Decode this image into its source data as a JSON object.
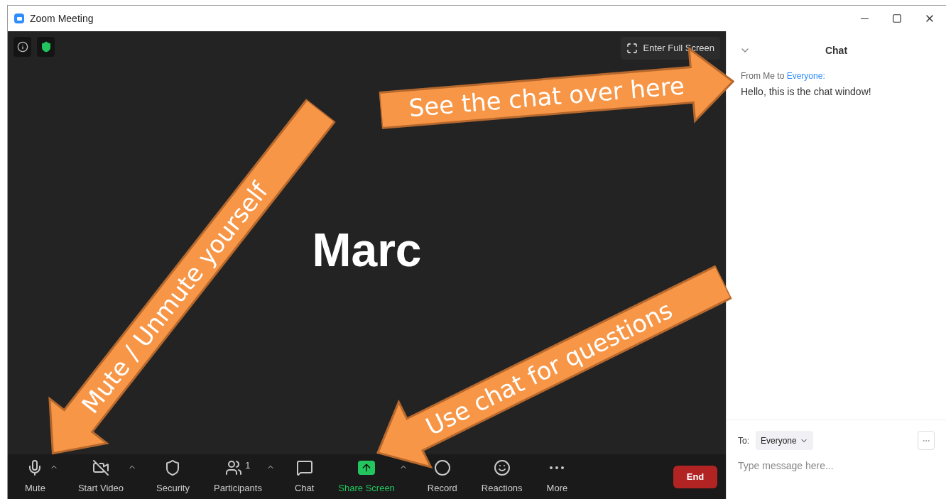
{
  "window": {
    "title": "Zoom Meeting"
  },
  "video": {
    "participant_name": "Marc",
    "full_screen_button": "Enter Full Screen"
  },
  "toolbar": {
    "items": [
      {
        "kind": "mic",
        "label": "Mute",
        "caret": true,
        "highlighted": false
      },
      {
        "kind": "video-off",
        "label": "Start Video",
        "caret": true,
        "highlighted": false
      },
      {
        "kind": "security",
        "label": "Security",
        "caret": false,
        "highlighted": false
      },
      {
        "kind": "participants",
        "label": "Participants",
        "count": "1",
        "caret": true,
        "highlighted": false
      },
      {
        "kind": "chat",
        "label": "Chat",
        "caret": false,
        "highlighted": false
      },
      {
        "kind": "share",
        "label": "Share Screen",
        "caret": true,
        "highlighted": true
      },
      {
        "kind": "record",
        "label": "Record",
        "caret": false,
        "highlighted": false
      },
      {
        "kind": "reactions",
        "label": "Reactions",
        "caret": false,
        "highlighted": false
      },
      {
        "kind": "more",
        "label": "More",
        "caret": false,
        "highlighted": false
      }
    ],
    "end_button": "End"
  },
  "chat": {
    "title": "Chat",
    "messages": [
      {
        "from": "From Me to",
        "to": "Everyone:",
        "text": "Hello, this is the chat window!"
      }
    ],
    "to_label": "To:",
    "recipient": "Everyone",
    "placeholder": "Type message here..."
  },
  "annotations": [
    {
      "text": "See the chat over here",
      "kind": "arrow-right"
    },
    {
      "text": "Mute / Unmute yourself",
      "kind": "arrow-left"
    },
    {
      "text": "Use chat for questions",
      "kind": "arrow-left"
    }
  ]
}
